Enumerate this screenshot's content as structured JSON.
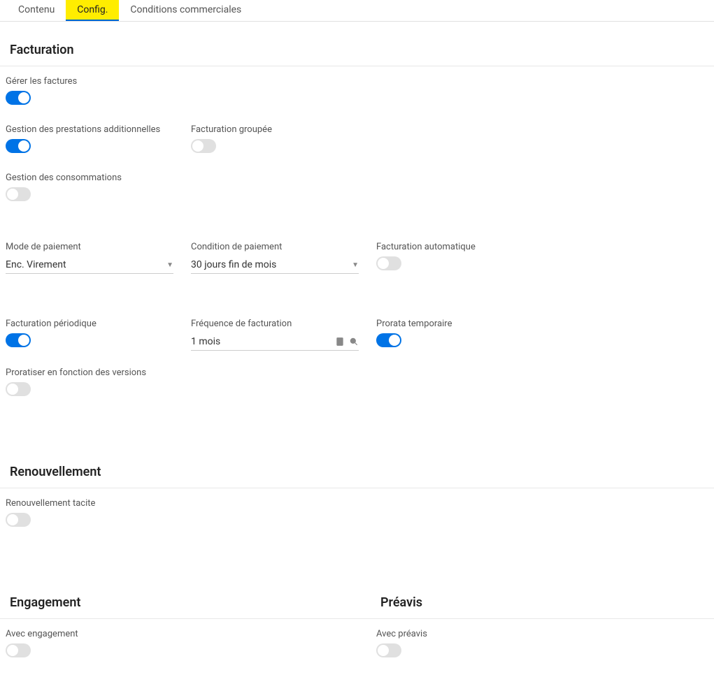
{
  "tabs": {
    "contenu": "Contenu",
    "config": "Config.",
    "conditions": "Conditions commerciales"
  },
  "sections": {
    "facturation": {
      "title": "Facturation",
      "gerer_factures": "Gérer les factures",
      "gestion_prestations": "Gestion des prestations additionnelles",
      "facturation_groupee": "Facturation groupée",
      "gestion_consommations": "Gestion des consommations",
      "mode_paiement_label": "Mode de paiement",
      "mode_paiement_value": "Enc. Virement",
      "condition_paiement_label": "Condition de paiement",
      "condition_paiement_value": "30 jours fin de mois",
      "facturation_auto": "Facturation automatique",
      "facturation_periodique": "Facturation périodique",
      "frequence_label": "Fréquence de facturation",
      "frequence_value": "1 mois",
      "prorata_temporaire": "Prorata temporaire",
      "proratiser_versions": "Proratiser en fonction des versions"
    },
    "renouvellement": {
      "title": "Renouvellement",
      "tacite": "Renouvellement tacite"
    },
    "engagement": {
      "title": "Engagement",
      "avec": "Avec engagement"
    },
    "preavis": {
      "title": "Préavis",
      "avec": "Avec préavis"
    }
  }
}
